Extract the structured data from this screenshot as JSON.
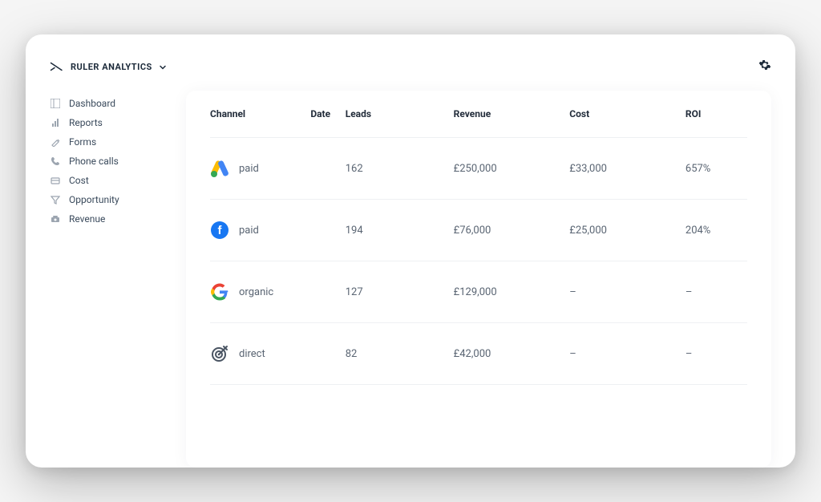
{
  "brand": {
    "name": "RULER ANALYTICS"
  },
  "sidebar": {
    "items": [
      {
        "label": "Dashboard",
        "icon": "dashboard-icon"
      },
      {
        "label": "Reports",
        "icon": "reports-icon"
      },
      {
        "label": "Forms",
        "icon": "forms-icon"
      },
      {
        "label": "Phone calls",
        "icon": "phone-icon"
      },
      {
        "label": "Cost",
        "icon": "cost-icon"
      },
      {
        "label": "Opportunity",
        "icon": "funnel-icon"
      },
      {
        "label": "Revenue",
        "icon": "revenue-icon"
      }
    ]
  },
  "table": {
    "headers": {
      "channel": "Channel",
      "date": "Date",
      "leads": "Leads",
      "revenue": "Revenue",
      "cost": "Cost",
      "roi": "ROI"
    },
    "rows": [
      {
        "icon": "google-ads",
        "channel": "paid",
        "date": "",
        "leads": "162",
        "revenue": "£250,000",
        "cost": "£33,000",
        "roi": "657%"
      },
      {
        "icon": "facebook",
        "channel": "paid",
        "date": "",
        "leads": "194",
        "revenue": "£76,000",
        "cost": "£25,000",
        "roi": "204%"
      },
      {
        "icon": "google",
        "channel": "organic",
        "date": "",
        "leads": "127",
        "revenue": "£129,000",
        "cost": "–",
        "roi": "–"
      },
      {
        "icon": "direct",
        "channel": "direct",
        "date": "",
        "leads": "82",
        "revenue": "£42,000",
        "cost": "–",
        "roi": "–"
      }
    ]
  }
}
